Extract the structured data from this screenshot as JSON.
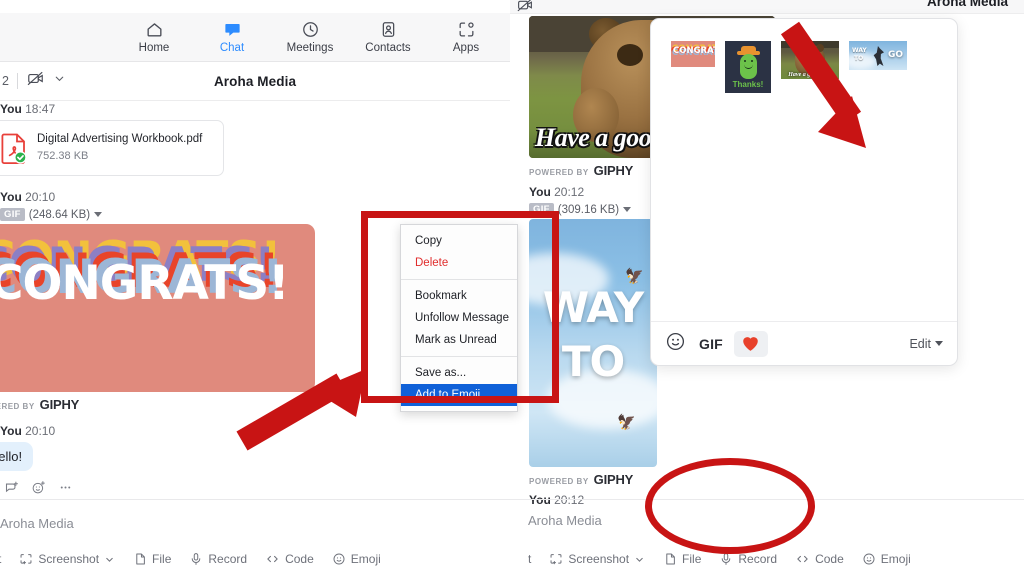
{
  "app": {
    "nav": [
      {
        "label": "Home",
        "icon": "home-icon",
        "active": false
      },
      {
        "label": "Chat",
        "icon": "chat-bubble-icon",
        "active": true
      },
      {
        "label": "Meetings",
        "icon": "clock-icon",
        "active": false
      },
      {
        "label": "Contacts",
        "icon": "contact-card-icon",
        "active": false
      },
      {
        "label": "Apps",
        "icon": "apps-grid-icon",
        "active": false
      }
    ],
    "subheader": {
      "badge_number": "2",
      "video_icon": "camera-off-icon",
      "chevron": "chevron-down-icon",
      "title": "Aroha Media"
    }
  },
  "messages": {
    "file_msg": {
      "sender": "You",
      "time": "18:47",
      "file_name": "Digital Advertising Workbook.pdf",
      "file_size": "752.38 KB",
      "file_icon": "pdf-file-icon",
      "status_icon": "check-circle-icon"
    },
    "gif_congrats": {
      "sender": "You",
      "time": "20:10",
      "badge": "GIF",
      "size": "(248.64 KB)",
      "text": "CONGRATS!",
      "powered_small": "POWERED BY",
      "powered_brand": "GIPHY"
    },
    "gif_way": {
      "sender": "You",
      "time": "20:12",
      "badge": "GIF",
      "size": "(309.16 KB)",
      "line1": "WAY",
      "line2": "TO",
      "powered_small": "POWERED BY",
      "powered_brand": "GIPHY"
    },
    "gif_bear": {
      "caption": "Have a good day!",
      "powered_small": "POWERED BY",
      "powered_brand": "GIPHY"
    },
    "hello_msg": {
      "sender": "You",
      "time": "20:10",
      "text": "hello!"
    },
    "reactions": [
      "reply-icon",
      "add-reaction-icon",
      "more-options-icon"
    ],
    "last_meta": {
      "sender": "You",
      "time": "20:12"
    }
  },
  "context_menu": {
    "items": [
      {
        "label": "Copy",
        "style": "normal"
      },
      {
        "label": "Delete",
        "style": "danger"
      },
      {
        "label": "Bookmark",
        "style": "normal"
      },
      {
        "label": "Unfollow Message",
        "style": "normal"
      },
      {
        "label": "Mark as Unread",
        "style": "normal"
      },
      {
        "label": "Save as...",
        "style": "normal"
      },
      {
        "label": "Add to Emoji",
        "style": "selected"
      }
    ]
  },
  "emoji_panel": {
    "thumbnails": [
      {
        "name": "congrats-gif-thumb",
        "label": "CONGRATS!"
      },
      {
        "name": "thanks-pickle-gif-thumb",
        "label": "Thanks!"
      },
      {
        "name": "bear-gif-thumb",
        "label": "Have a good day!"
      },
      {
        "name": "way-to-go-gif-thumb",
        "label": "WAY TO GO"
      }
    ],
    "footer": {
      "smiley_icon": "smiley-face-icon",
      "gif_label": "GIF",
      "heart_icon": "heart-icon",
      "edit_label": "Edit",
      "edit_caret": "caret-down-icon"
    }
  },
  "compose": {
    "placeholder": "Aroha Media",
    "toolbar": [
      {
        "label": "t",
        "icon": "text-format-icon"
      },
      {
        "label": "Screenshot",
        "icon": "screenshot-icon",
        "has_caret": true
      },
      {
        "label": "File",
        "icon": "file-icon"
      },
      {
        "label": "Record",
        "icon": "microphone-icon"
      },
      {
        "label": "Code",
        "icon": "code-brackets-icon"
      },
      {
        "label": "Emoji",
        "icon": "smiley-face-icon"
      }
    ]
  },
  "annotations": {
    "color": "#c81414",
    "items": [
      {
        "name": "context-menu-highlight-rect",
        "shape": "rectangle"
      },
      {
        "name": "pointer-arrow-to-menu",
        "shape": "arrow"
      },
      {
        "name": "pointer-arrow-to-emoji-panel",
        "shape": "arrow"
      },
      {
        "name": "emoji-bar-highlight-circle",
        "shape": "ellipse"
      }
    ]
  },
  "colors": {
    "accent": "#2d8cff",
    "selected_menu": "#1061d8",
    "danger": "#e02c2c",
    "annotation_red": "#c81414",
    "congrats_bg": "#e08a7d",
    "bubble_bg": "#e3f0fc"
  }
}
